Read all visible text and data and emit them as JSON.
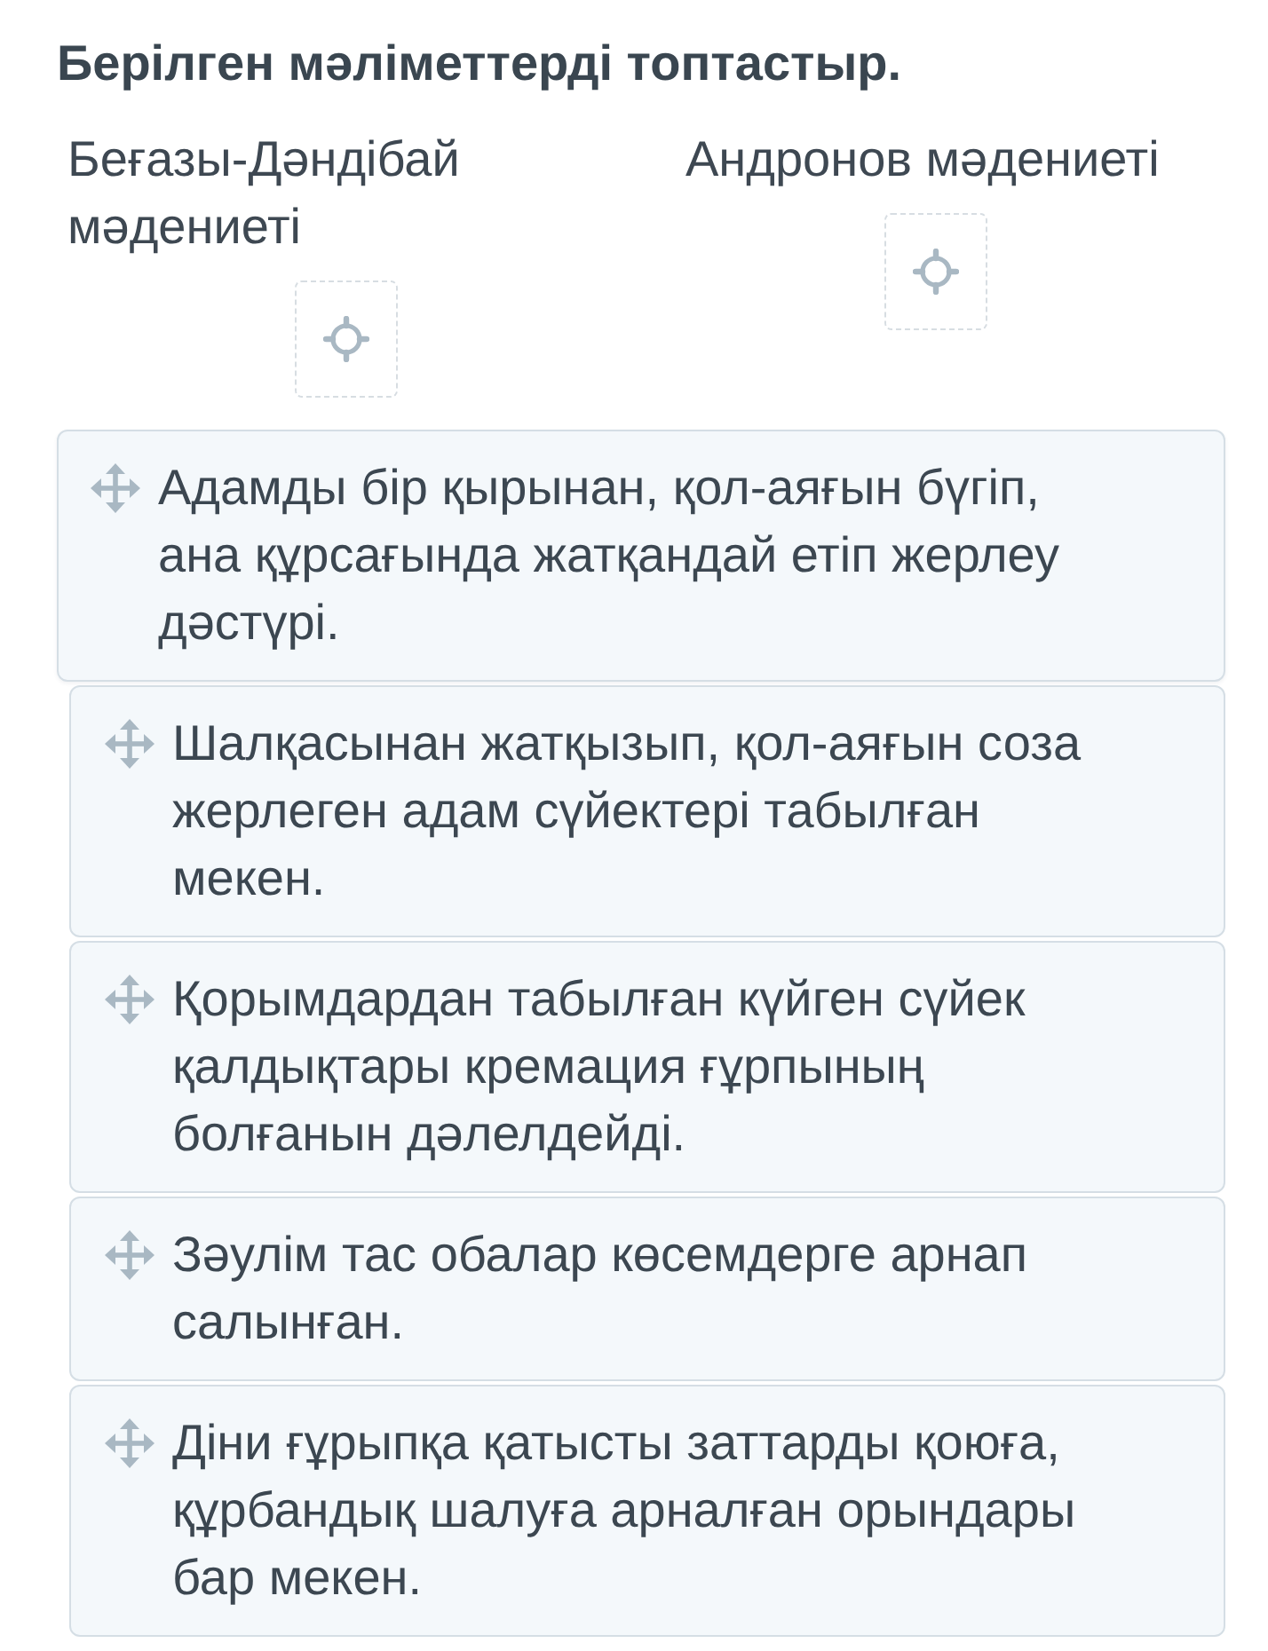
{
  "title": "Берілген мәліметтерді топтастыр.",
  "categories": [
    {
      "label": "Беғазы-Дәндібай мәдениеті"
    },
    {
      "label": "Андронов мәдениеті"
    }
  ],
  "items": [
    {
      "text": "Адамды бір қырынан, қол-аяғын бүгіп, ана құрсағында жатқандай етіп жерлеу дәстүрі.",
      "dragging": true
    },
    {
      "text": "Шалқасынан жатқызып, қол-аяғын соза жерлеген адам сүйектері табылған мекен.",
      "dragging": false
    },
    {
      "text": "Қорымдардан табылған күйген сүйек қалдықтары кремация ғұрпының болғанын дәлелдейді.",
      "dragging": false
    },
    {
      "text": "Зәулім тас обалар көсемдерге арнап салынған.",
      "dragging": false
    },
    {
      "text": "Діни ғұрыпқа қатысты заттарды қоюға, құрбандық шалуға арналған орындары бар мекен.",
      "dragging": false
    }
  ]
}
